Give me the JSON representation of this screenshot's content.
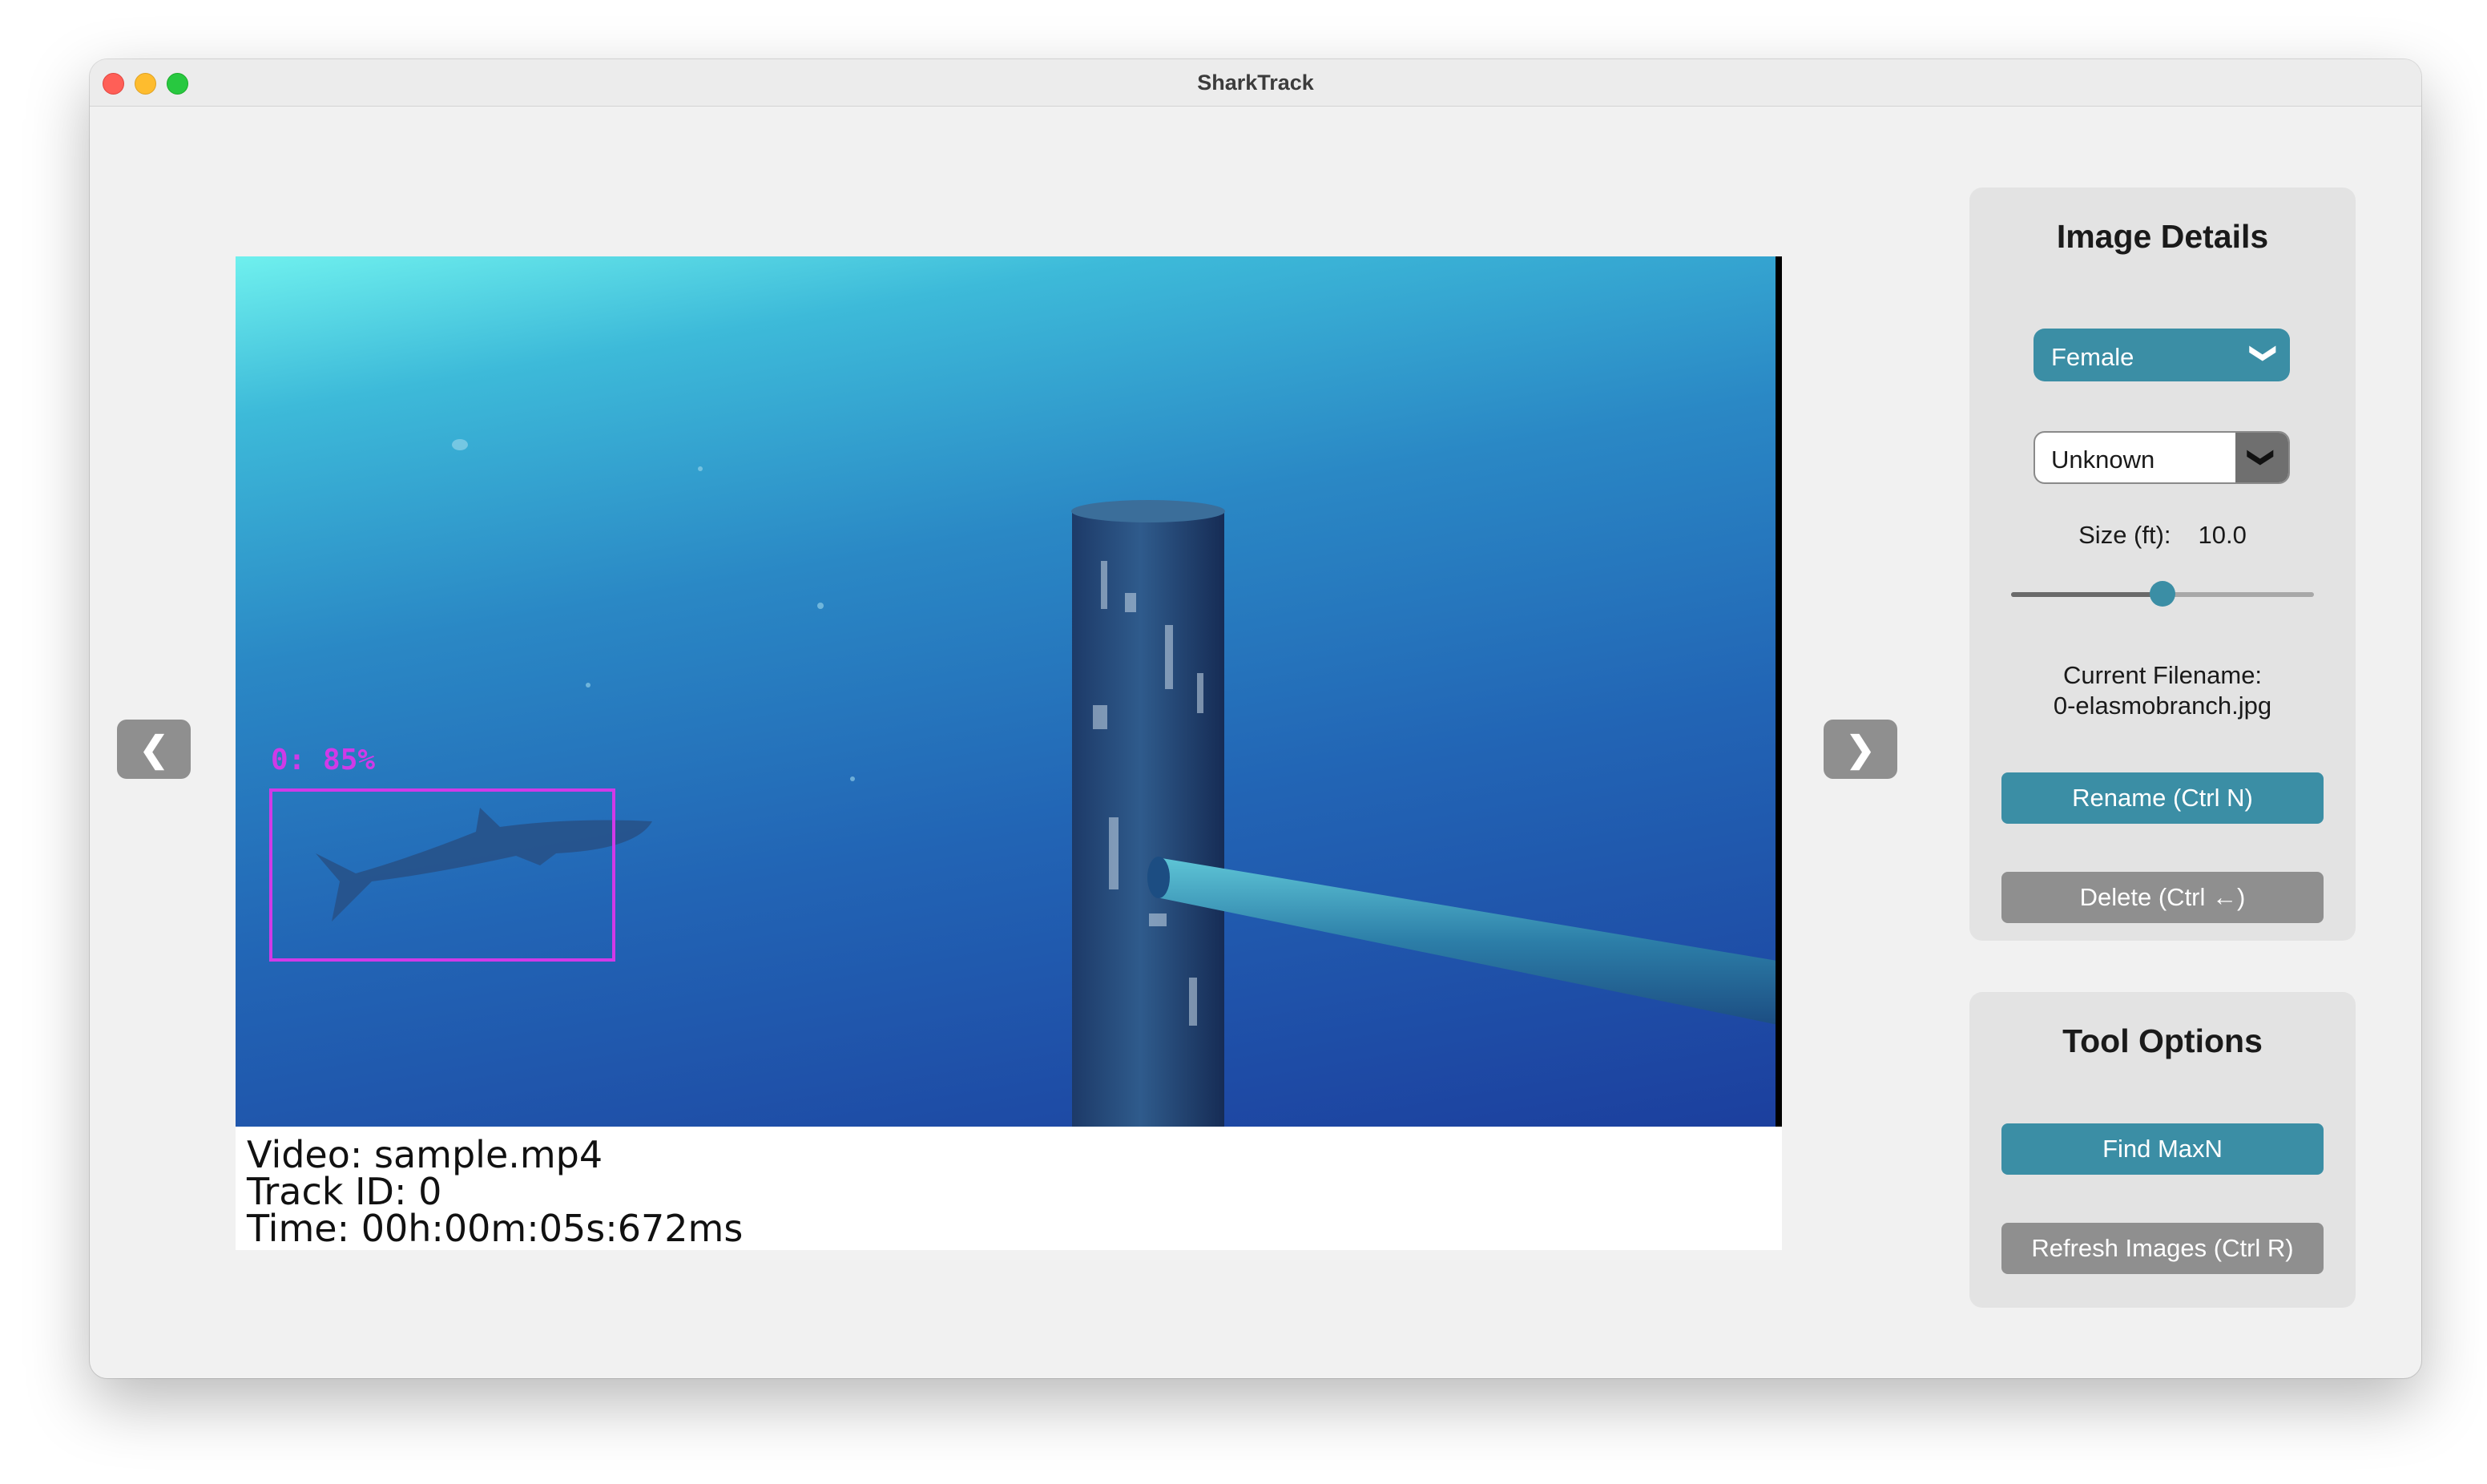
{
  "window": {
    "title": "SharkTrack"
  },
  "navigation": {
    "prev_icon": "❮",
    "next_icon": "❯"
  },
  "image": {
    "detection_label": "0: 85%",
    "caption": [
      "Video: sample.mp4",
      "Track ID: 0",
      "Time: 00h:00m:05s:672ms"
    ]
  },
  "image_details": {
    "title": "Image Details",
    "sex_dropdown": {
      "value": "Female",
      "chevron": "❯"
    },
    "second_dropdown": {
      "value": "Unknown",
      "chevron": "❯"
    },
    "size": {
      "label": "Size (ft):",
      "value": "10.0",
      "slider_fraction": 0.5
    },
    "filename": {
      "label": "Current Filename:",
      "value": "0-elasmobranch.jpg"
    },
    "rename_button": "Rename (Ctrl N)",
    "delete_button": "Delete (Ctrl ←)"
  },
  "tool_options": {
    "title": "Tool Options",
    "find_maxn_button": "Find MaxN",
    "refresh_button": "Refresh Images (Ctrl R)"
  },
  "colors": {
    "accent": "#3b8ea5",
    "secondary_button": "#8f8f8f",
    "detection": "#d03ae8"
  }
}
